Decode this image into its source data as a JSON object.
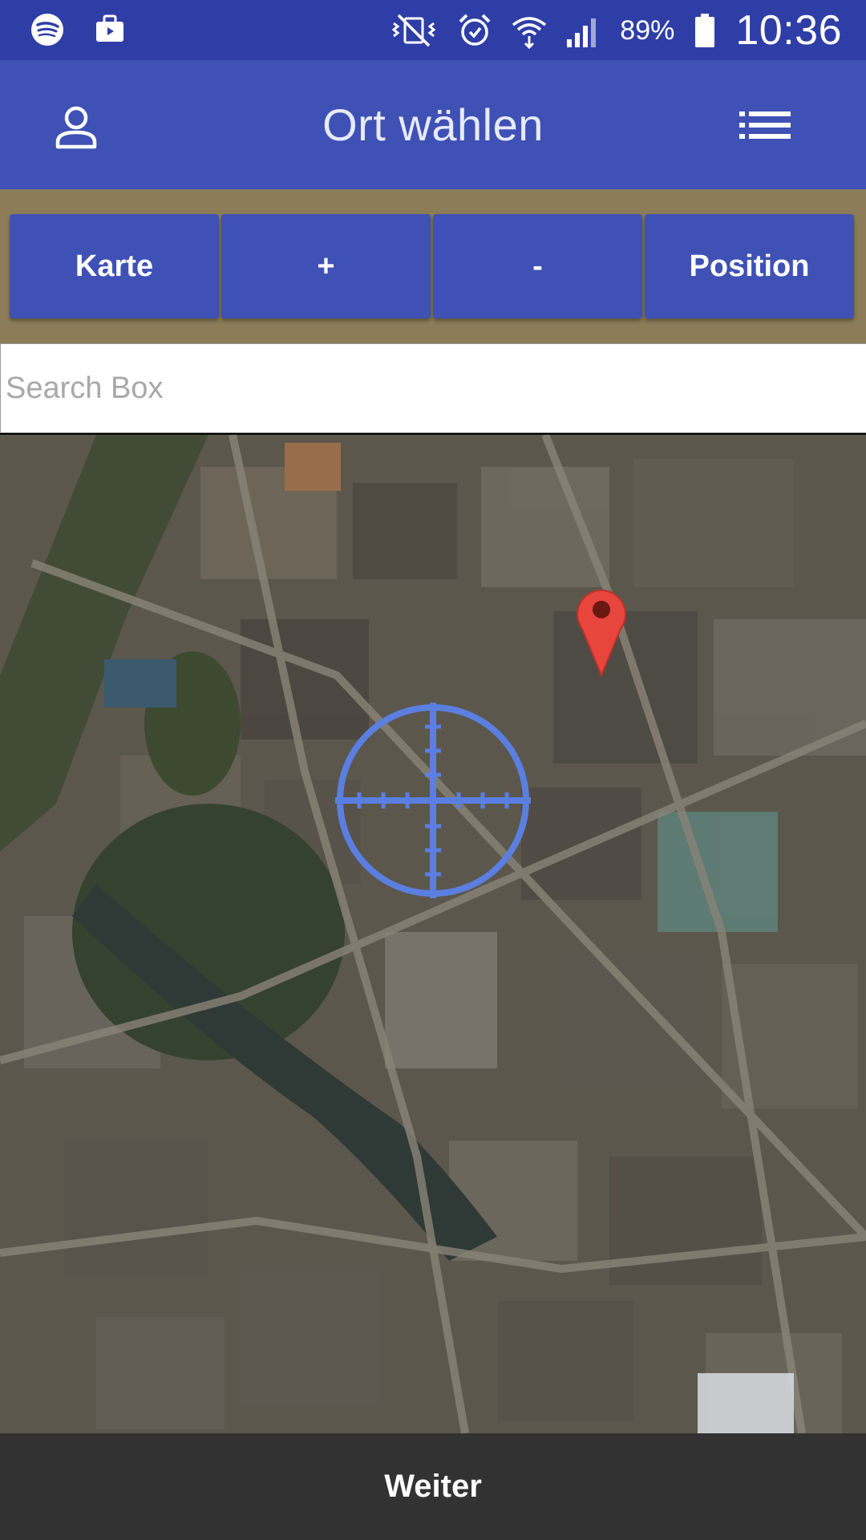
{
  "status_bar": {
    "battery_percent": "89%",
    "time": "10:36",
    "icons": [
      "spotify-icon",
      "briefcase-icon",
      "vibrate-off-icon",
      "alarm-icon",
      "wifi-icon",
      "signal-icon",
      "battery-icon"
    ]
  },
  "app_bar": {
    "title": "Ort wählen",
    "left_icon": "profile-icon",
    "right_icon": "list-icon"
  },
  "toolbar": {
    "karte_label": "Karte",
    "zoom_in_label": "+",
    "zoom_out_label": "-",
    "position_label": "Position"
  },
  "search": {
    "placeholder": "Search Box",
    "value": ""
  },
  "map": {
    "type": "satellite",
    "marker_icon": "map-pin-icon",
    "crosshair_icon": "crosshair-icon"
  },
  "footer": {
    "next_label": "Weiter"
  },
  "colors": {
    "status_bar": "#2f3ea6",
    "primary": "#3f51b5",
    "strip_background": "#8c7d58",
    "footer": "#323232",
    "crosshair": "#5b7fe0",
    "marker": "#e8453c"
  }
}
